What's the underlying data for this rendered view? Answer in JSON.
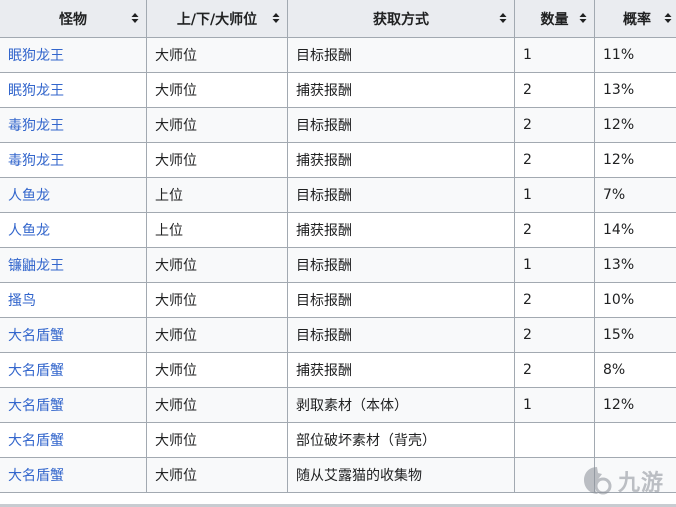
{
  "table": {
    "headers": [
      "怪物",
      "上/下/大师位",
      "获取方式",
      "数量",
      "概率"
    ],
    "rows": [
      {
        "monster": "眠狗龙王",
        "rank": "大师位",
        "method": "目标报酬",
        "qty": "1",
        "rate": "11%"
      },
      {
        "monster": "眠狗龙王",
        "rank": "大师位",
        "method": "捕获报酬",
        "qty": "2",
        "rate": "13%"
      },
      {
        "monster": "毒狗龙王",
        "rank": "大师位",
        "method": "目标报酬",
        "qty": "2",
        "rate": "12%"
      },
      {
        "monster": "毒狗龙王",
        "rank": "大师位",
        "method": "捕获报酬",
        "qty": "2",
        "rate": "12%"
      },
      {
        "monster": "人鱼龙",
        "rank": "上位",
        "method": "目标报酬",
        "qty": "1",
        "rate": "7%"
      },
      {
        "monster": "人鱼龙",
        "rank": "上位",
        "method": "捕获报酬",
        "qty": "2",
        "rate": "14%"
      },
      {
        "monster": "镰鼬龙王",
        "rank": "大师位",
        "method": "目标报酬",
        "qty": "1",
        "rate": "13%"
      },
      {
        "monster": "搔鸟",
        "rank": "大师位",
        "method": "目标报酬",
        "qty": "2",
        "rate": "10%"
      },
      {
        "monster": "大名盾蟹",
        "rank": "大师位",
        "method": "目标报酬",
        "qty": "2",
        "rate": "15%"
      },
      {
        "monster": "大名盾蟹",
        "rank": "大师位",
        "method": "捕获报酬",
        "qty": "2",
        "rate": "8%"
      },
      {
        "monster": "大名盾蟹",
        "rank": "大师位",
        "method": "剥取素材（本体）",
        "qty": "1",
        "rate": "12%"
      },
      {
        "monster": "大名盾蟹",
        "rank": "大师位",
        "method": "部位破坏素材（背壳）",
        "qty": "",
        "rate": ""
      },
      {
        "monster": "大名盾蟹",
        "rank": "大师位",
        "method": "随从艾露猫的收集物",
        "qty": "",
        "rate": ""
      }
    ]
  },
  "watermark": {
    "text": "九游",
    "icon": "jiuyou-logo-icon"
  },
  "colors": {
    "link": "#3366cc",
    "header_bg": "#eaecf0",
    "border": "#a2a9b1",
    "stripe": "#f8f9fa"
  }
}
